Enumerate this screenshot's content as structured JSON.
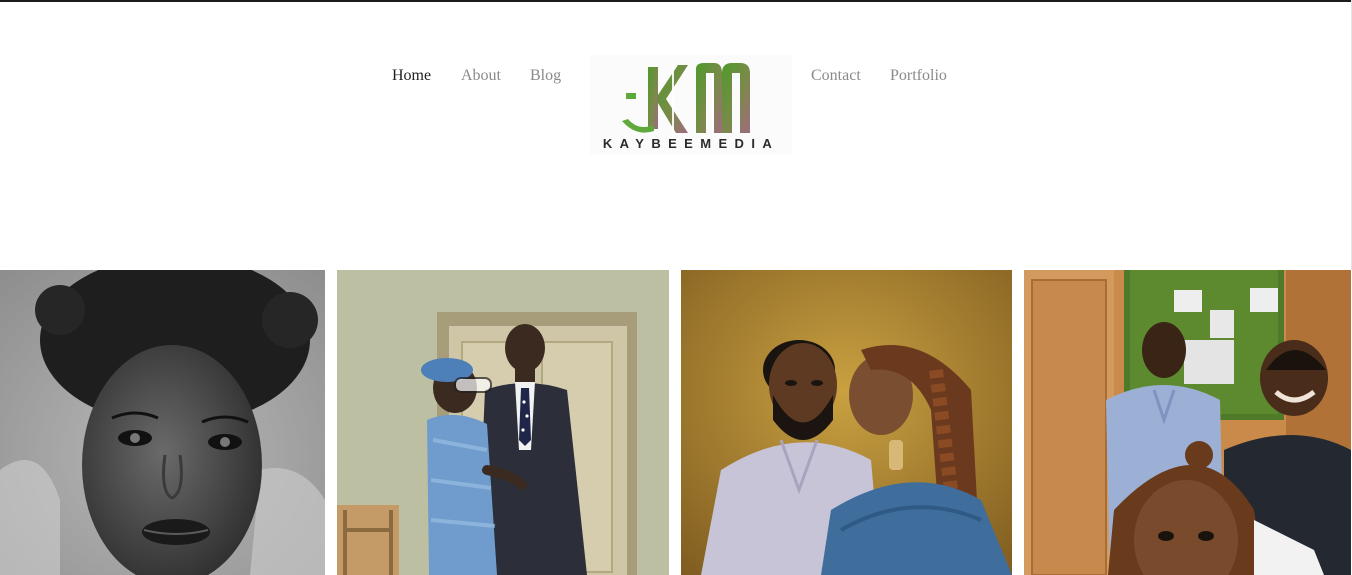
{
  "nav": {
    "items": [
      {
        "label": "Home",
        "active": true
      },
      {
        "label": "About"
      },
      {
        "label": "Blog"
      },
      {
        "label": "Contact"
      },
      {
        "label": "Portfolio"
      }
    ]
  },
  "logo": {
    "monogram": "KM",
    "wordmark": "KAYBEEMEDIA",
    "colors": {
      "green": "#5a9a2e",
      "mauve": "#9a6a7a"
    }
  },
  "gallery": {
    "photos": [
      {
        "subject": "black and white portrait of a woman in a fur hood"
      },
      {
        "subject": "couple posing in front of a door"
      },
      {
        "subject": "couple portrait on a golden backdrop"
      },
      {
        "subject": "group selfie of three friends"
      }
    ]
  },
  "colors": {
    "nav_text": "#8a8a8a",
    "nav_active": "#222222",
    "top_rule": "#1c1c1c"
  }
}
